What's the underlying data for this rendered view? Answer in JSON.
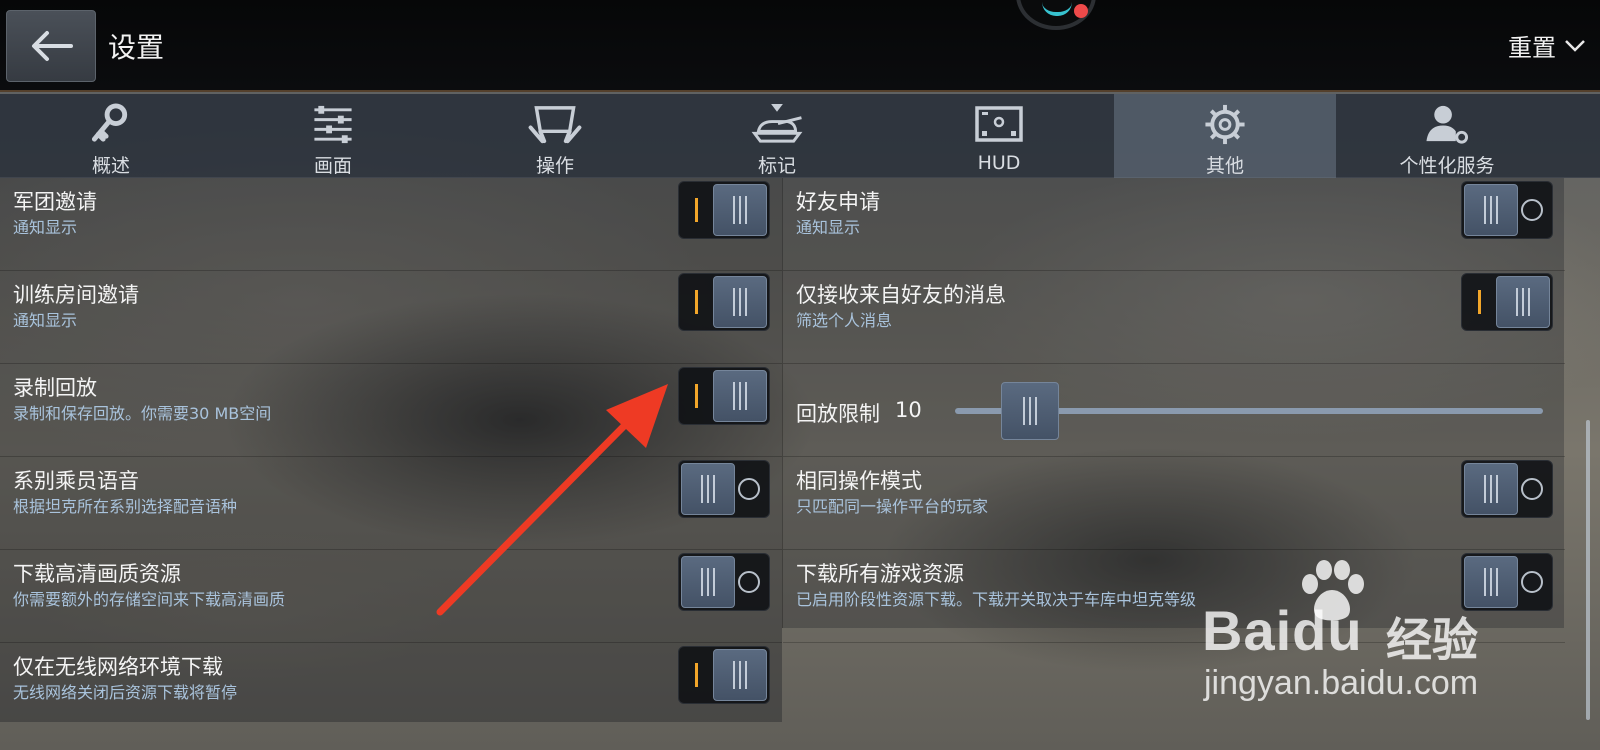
{
  "header": {
    "title": "设置",
    "reset_label": "重置"
  },
  "tabs": [
    {
      "label": "概述",
      "icon": "key-icon",
      "active": false
    },
    {
      "label": "画面",
      "icon": "sliders-icon",
      "active": false
    },
    {
      "label": "操作",
      "icon": "control-icon",
      "active": false
    },
    {
      "label": "标记",
      "icon": "tank-marker-icon",
      "active": false
    },
    {
      "label": "HUD",
      "icon": "hud-screen-icon",
      "active": false
    },
    {
      "label": "其他",
      "icon": "gear-icon",
      "active": true
    },
    {
      "label": "个性化服务",
      "icon": "user-settings-icon",
      "active": false
    }
  ],
  "left_settings": [
    {
      "title": "军团邀请",
      "subtitle": "通知显示",
      "enabled": true
    },
    {
      "title": "训练房间邀请",
      "subtitle": "通知显示",
      "enabled": true
    },
    {
      "title": "录制回放",
      "subtitle": "录制和保存回放。你需要30 MB空间",
      "enabled": true
    },
    {
      "title": "系别乘员语音",
      "subtitle": "根据坦克所在系别选择配音语种",
      "enabled": false
    },
    {
      "title": "下载高清画质资源",
      "subtitle": "你需要额外的存储空间来下载高清画质",
      "enabled": false
    },
    {
      "title": "仅在无线网络环境下载",
      "subtitle": "无线网络关闭后资源下载将暂停",
      "enabled": true
    }
  ],
  "right_settings": [
    {
      "title": "好友申请",
      "subtitle": "通知显示",
      "enabled": false
    },
    {
      "title": "仅接收来自好友的消息",
      "subtitle": "筛选个人消息",
      "enabled": true
    }
  ],
  "replay_limit": {
    "label": "回放限制",
    "value": "10",
    "slider_fraction": 0.08
  },
  "right_settings_lower": [
    {
      "title": "相同操作模式",
      "subtitle": "只匹配同一操作平台的玩家",
      "enabled": false
    },
    {
      "title": "下载所有游戏资源",
      "subtitle": "已启用阶段性资源下载。下载开关取决于车库中坦克等级",
      "enabled": false
    }
  ],
  "watermark": {
    "brand": "Bai",
    "brand_du": "du",
    "cn": "经验",
    "url": "jingyan.baidu.com"
  },
  "colors": {
    "toggle_on_mark": "#f2a62a",
    "subtitle": "#a9c3dc",
    "annotation_arrow": "#ee3a24"
  }
}
